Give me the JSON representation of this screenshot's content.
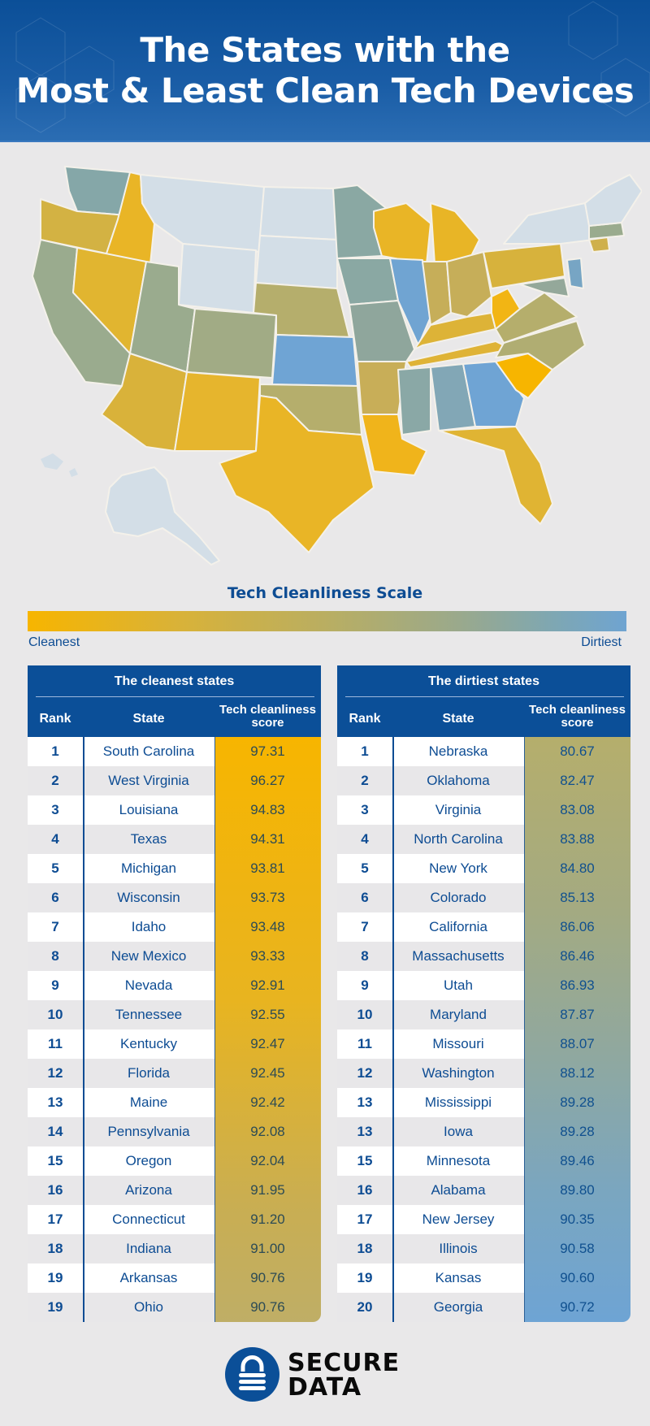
{
  "header": {
    "title_line1": "The States with the",
    "title_line2": "Most & Least Clean Tech Devices"
  },
  "map": {
    "description": "US choropleth map colored by tech cleanliness score",
    "colors": {
      "cleanest": "#f7b500",
      "mid_clean": "#e1b530",
      "mid": "#b5ae6c",
      "mid_dirty": "#9aab8e",
      "dirty": "#85a7a8",
      "dirtiest": "#6fa4d4",
      "no_data": "#d3dee7"
    }
  },
  "scale": {
    "title": "Tech Cleanliness Scale",
    "left_label": "Cleanest",
    "right_label": "Dirtiest",
    "gradient_start": "#f7b500",
    "gradient_end": "#6fa4d4"
  },
  "chart_data": {
    "type": "table",
    "title": "The States with the Most & Least Clean Tech Devices",
    "tables": [
      {
        "title": "The cleanest states",
        "columns": [
          "Rank",
          "State",
          "Tech cleanliness score"
        ],
        "rows": [
          {
            "rank": "1",
            "state": "South Carolina",
            "score": "97.31"
          },
          {
            "rank": "2",
            "state": "West Virginia",
            "score": "96.27"
          },
          {
            "rank": "3",
            "state": "Louisiana",
            "score": "94.83"
          },
          {
            "rank": "4",
            "state": "Texas",
            "score": "94.31"
          },
          {
            "rank": "5",
            "state": "Michigan",
            "score": "93.81"
          },
          {
            "rank": "6",
            "state": "Wisconsin",
            "score": "93.73"
          },
          {
            "rank": "7",
            "state": "Idaho",
            "score": "93.48"
          },
          {
            "rank": "8",
            "state": "New Mexico",
            "score": "93.33"
          },
          {
            "rank": "9",
            "state": "Nevada",
            "score": "92.91"
          },
          {
            "rank": "10",
            "state": "Tennessee",
            "score": "92.55"
          },
          {
            "rank": "11",
            "state": "Kentucky",
            "score": "92.47"
          },
          {
            "rank": "12",
            "state": "Florida",
            "score": "92.45"
          },
          {
            "rank": "13",
            "state": "Maine",
            "score": "92.42"
          },
          {
            "rank": "14",
            "state": "Pennsylvania",
            "score": "92.08"
          },
          {
            "rank": "15",
            "state": "Oregon",
            "score": "92.04"
          },
          {
            "rank": "16",
            "state": "Arizona",
            "score": "91.95"
          },
          {
            "rank": "17",
            "state": "Connecticut",
            "score": "91.20"
          },
          {
            "rank": "18",
            "state": "Indiana",
            "score": "91.00"
          },
          {
            "rank": "19",
            "state": "Arkansas",
            "score": "90.76"
          },
          {
            "rank": "19",
            "state": "Ohio",
            "score": "90.76"
          }
        ]
      },
      {
        "title": "The dirtiest states",
        "columns": [
          "Rank",
          "State",
          "Tech cleanliness score"
        ],
        "rows": [
          {
            "rank": "1",
            "state": "Nebraska",
            "score": "80.67"
          },
          {
            "rank": "2",
            "state": "Oklahoma",
            "score": "82.47"
          },
          {
            "rank": "3",
            "state": "Virginia",
            "score": "83.08"
          },
          {
            "rank": "4",
            "state": "North Carolina",
            "score": "83.88"
          },
          {
            "rank": "5",
            "state": "New York",
            "score": "84.80"
          },
          {
            "rank": "6",
            "state": "Colorado",
            "score": "85.13"
          },
          {
            "rank": "7",
            "state": "California",
            "score": "86.06"
          },
          {
            "rank": "8",
            "state": "Massachusetts",
            "score": "86.46"
          },
          {
            "rank": "9",
            "state": "Utah",
            "score": "86.93"
          },
          {
            "rank": "10",
            "state": "Maryland",
            "score": "87.87"
          },
          {
            "rank": "11",
            "state": "Missouri",
            "score": "88.07"
          },
          {
            "rank": "12",
            "state": "Washington",
            "score": "88.12"
          },
          {
            "rank": "13",
            "state": "Mississippi",
            "score": "89.28"
          },
          {
            "rank": "13",
            "state": "Iowa",
            "score": "89.28"
          },
          {
            "rank": "15",
            "state": "Minnesota",
            "score": "89.46"
          },
          {
            "rank": "16",
            "state": "Alabama",
            "score": "89.80"
          },
          {
            "rank": "17",
            "state": "New Jersey",
            "score": "90.35"
          },
          {
            "rank": "18",
            "state": "Illinois",
            "score": "90.58"
          },
          {
            "rank": "19",
            "state": "Kansas",
            "score": "90.60"
          },
          {
            "rank": "20",
            "state": "Georgia",
            "score": "90.72"
          }
        ]
      }
    ]
  },
  "logo": {
    "line1": "SECURE",
    "line2": "DATA",
    "brand_color": "#0b4f98",
    "icon": "padlock-icon"
  }
}
